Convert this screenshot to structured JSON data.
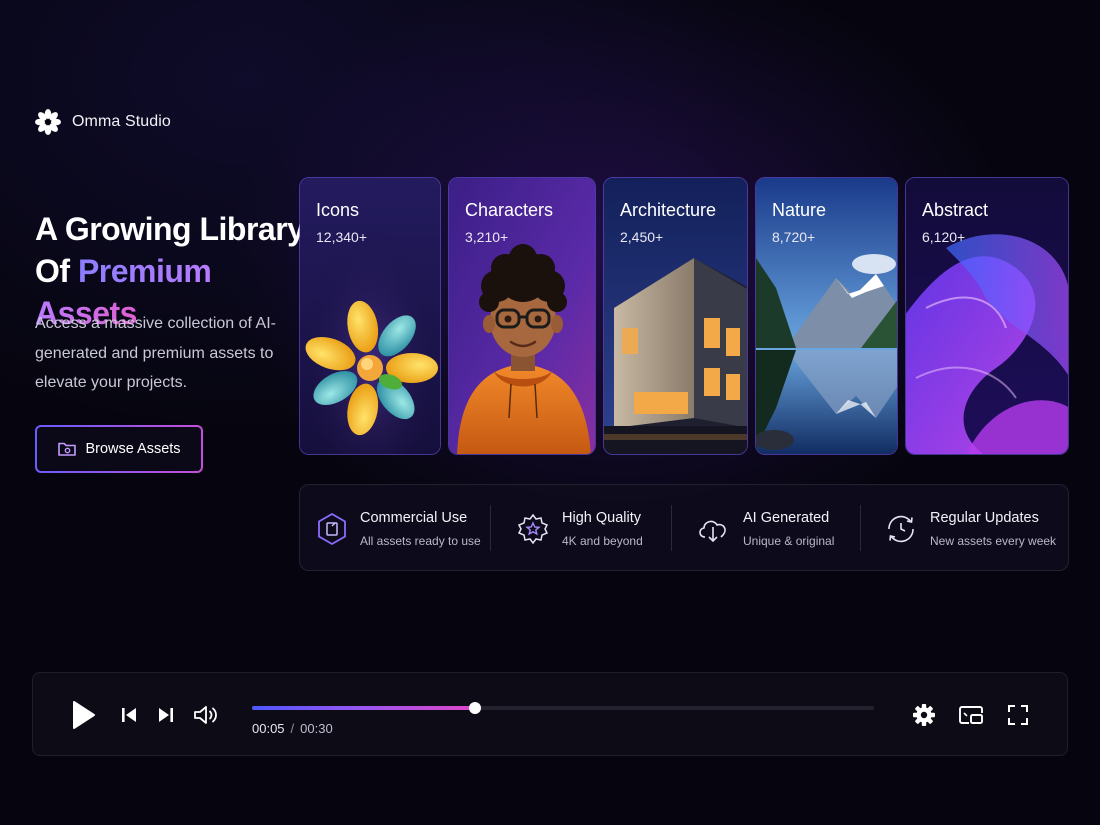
{
  "brand": {
    "name": "Omma Studio",
    "logo_icon": "flower-icon"
  },
  "hero": {
    "title_line1": "A Growing Library",
    "title_line2_prefix": "Of ",
    "title_line2_accent": "Premium Assets",
    "description": "Access a massive collection of AI-generated and premium assets to elevate your projects.",
    "button_label": "Browse Assets",
    "button_icon": "folder-icon"
  },
  "categories": [
    {
      "title": "Icons",
      "count": "12,340+",
      "image": "3d-flower-icon"
    },
    {
      "title": "Characters",
      "count": "3,210+",
      "image": "cartoon-boy-with-glasses"
    },
    {
      "title": "Architecture",
      "count": "2,450+",
      "image": "modern-building-at-dusk"
    },
    {
      "title": "Nature",
      "count": "8,720+",
      "image": "mountain-lake-reflection"
    },
    {
      "title": "Abstract",
      "count": "6,120+",
      "image": "purple-wave-swirls"
    }
  ],
  "features": [
    {
      "title": "Commercial Use",
      "subtitle": "All assets ready to use",
      "icon": "hexagon-license-icon"
    },
    {
      "title": "High Quality",
      "subtitle": "4K and beyond",
      "icon": "star-badge-icon"
    },
    {
      "title": "AI Generated",
      "subtitle": "Unique & original",
      "icon": "cloud-download-icon"
    },
    {
      "title": "Regular Updates",
      "subtitle": "New assets every week",
      "icon": "refresh-clock-icon"
    }
  ],
  "player": {
    "current_time": "00:05",
    "separator": "/",
    "total_time": "00:30",
    "progress": 0.358
  },
  "colors": {
    "background": "#06050f",
    "accent_start": "#6a5cff",
    "accent_end": "#e046c8",
    "card_border": "#785fff"
  }
}
